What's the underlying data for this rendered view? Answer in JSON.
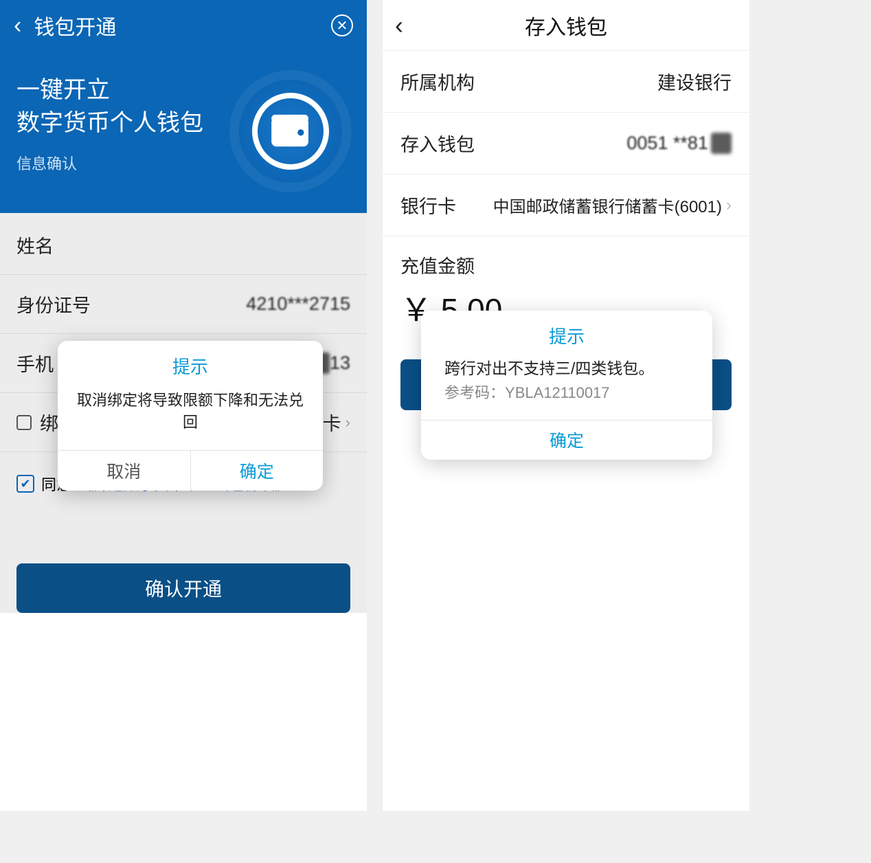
{
  "left": {
    "header": {
      "title": "钱包开通"
    },
    "hero": {
      "line1": "一键开立",
      "line2": "数字货币个人钱包",
      "sub": "信息确认"
    },
    "form": {
      "name_label": "姓名",
      "id_label": "身份证号",
      "id_value": "4210***2715",
      "phone_label": "手机",
      "phone_value_suffix": "13",
      "bindcard_label": "绑定银行卡",
      "bindcard_hint": "卡",
      "agree_text": "同意",
      "agreement_link": "《开通数字货币个人钱包协议》",
      "confirm": "确认开通"
    },
    "dialog": {
      "title": "提示",
      "body": "取消绑定将导致限额下降和无法兑回",
      "cancel": "取消",
      "ok": "确定"
    }
  },
  "right": {
    "header": {
      "title": "存入钱包"
    },
    "rows": {
      "org_label": "所属机构",
      "org_value": "建设银行",
      "wallet_label": "存入钱包",
      "wallet_value": "0051 **81",
      "card_label": "银行卡",
      "card_value": "中国邮政储蓄银行储蓄卡(6001)"
    },
    "amount": {
      "label": "充值金额",
      "value": "￥ 5.00"
    },
    "dialog": {
      "title": "提示",
      "body_line1": "跨行对出不支持三/四类钱包。",
      "body_ref_label": "参考码：",
      "body_ref_code": "YBLA12110017",
      "ok": "确定"
    }
  }
}
